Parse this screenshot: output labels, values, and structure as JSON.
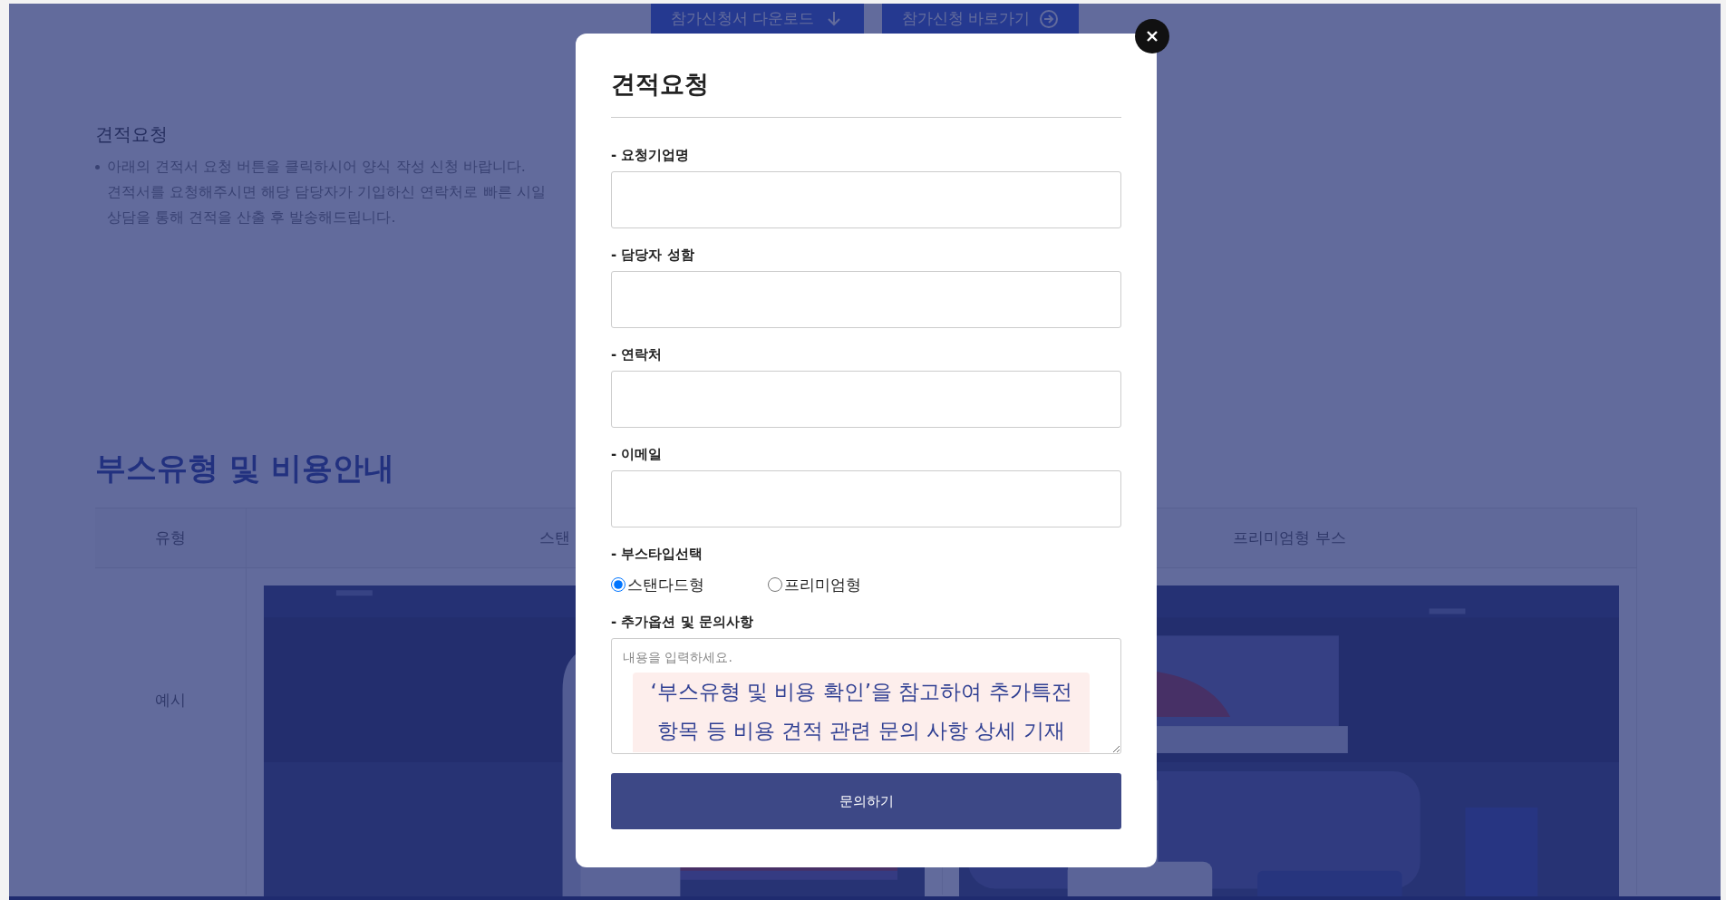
{
  "page": {
    "top_buttons": [
      {
        "label": "참가신청서 다운로드",
        "kind": "download"
      },
      {
        "label": "참가신청 바로가기",
        "kind": "link"
      }
    ],
    "intro": {
      "title": "견적요청",
      "bullet_lines": [
        "아래의 견적서 요청 버튼을 클릭하시어 양식 작성 신청 바랍니다.",
        "견적서를 요청해주시면 해당 담당자가 기입하신 연락처로 빠른 시일",
        "상담을 통해 견적을 산출 후 발송해드립니다."
      ]
    },
    "booth_section": {
      "heading": "부스유형 및 비용안내",
      "table": {
        "columns": [
          "유형",
          "스탠",
          "프리미엄형 부스"
        ],
        "rows": [
          {
            "label": "예시"
          }
        ]
      }
    }
  },
  "modal": {
    "title": "견적요청",
    "fields": [
      {
        "label": "- 요청기업명"
      },
      {
        "label": "- 담당자 성함"
      },
      {
        "label": "- 연락처"
      },
      {
        "label": "- 이메일"
      }
    ],
    "booth_type": {
      "label": "- 부스타입선택",
      "options": [
        {
          "label": "스탠다드형",
          "selected": true
        },
        {
          "label": "프리미엄형",
          "selected": false
        }
      ]
    },
    "inquiry": {
      "label": "- 추가옵션 및 문의사항",
      "placeholder": "내용을 입력하세요."
    },
    "note_lines": [
      "‘부스유형 및 비용 확인’을 참고하여 추가특전",
      "항목 등 비용 견적 관련 문의 사항 상세 기재"
    ],
    "submit": "문의하기"
  }
}
